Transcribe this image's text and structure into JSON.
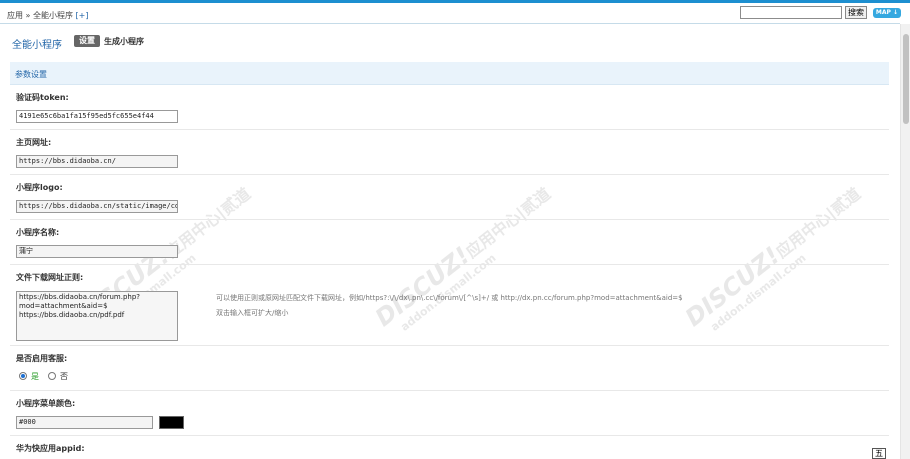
{
  "header": {
    "breadcrumb_app": "应用",
    "breadcrumb_sep": "»",
    "breadcrumb_page": "全能小程序",
    "breadcrumb_plus": "[+]",
    "search_value": "",
    "search_button": "搜索",
    "map_button": "MAP"
  },
  "page": {
    "title": "全能小程序",
    "tab_settings": "设置",
    "tab_generate": "生成小程序",
    "section_title": "参数设置"
  },
  "form": {
    "token_label": "验证码token:",
    "token_value": "4191e65c6ba1fa15f95ed5fc655e4f44",
    "homepage_label": "主页网址:",
    "homepage_value": "https://bbs.didaoba.cn/",
    "logo_label": "小程序logo:",
    "logo_value": "https://bbs.didaoba.cn/static/image/com",
    "name_label": "小程序名称:",
    "name_value": "蒲宁",
    "download_label": "文件下载网址正则:",
    "download_value": "https://bbs.didaoba.cn/forum.php?\nmod=attachment&aid=$\nhttps://bbs.didaoba.cn/pdf.pdf",
    "download_hint_1": "可以使用正则或原网址匹配文件下载网址，例如/https?:\\/\\/dx\\.pn\\.cc\\/forum\\/[^\\s]+/ 或 http://dx.pn.cc/forum.php?mod=attachment&aid=$",
    "download_hint_2": "双击输入框可扩大/缩小",
    "support_label": "是否启用客服:",
    "support_yes": "是",
    "support_no": "否",
    "support_selected": "是",
    "menu_color_label": "小程序菜单颜色:",
    "menu_color_value": "#000",
    "huawei_label": "华为快应用appid:"
  },
  "watermark": {
    "brand": "DISCUZ!",
    "cn": "应用中心",
    "sep": "|",
    "cn2": "贰道",
    "url": "addon.dismall.com"
  },
  "corner_button": "五",
  "colors": {
    "accent": "#2366a8",
    "topline": "#1d8fd0",
    "section_bg": "#e9f3fb",
    "menu_color_swatch": "#000000"
  }
}
